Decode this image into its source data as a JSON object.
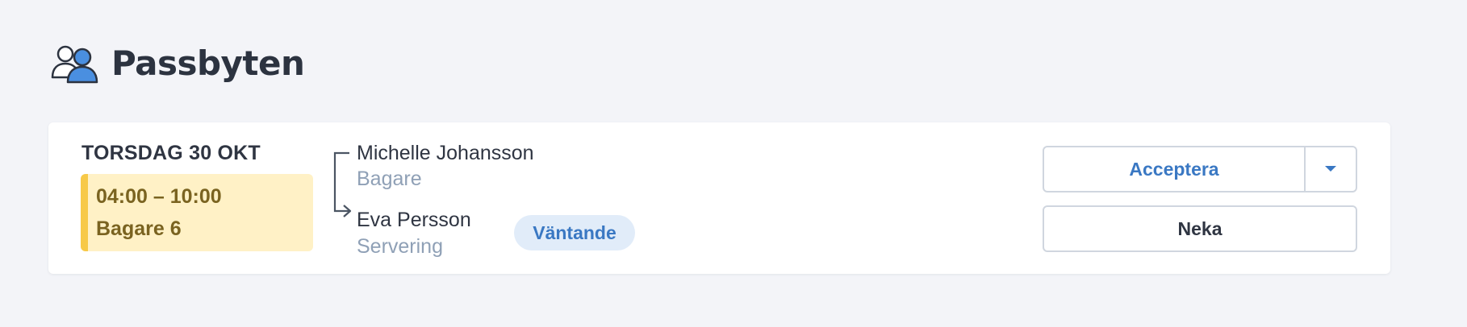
{
  "header": {
    "title": "Passbyten",
    "icon": "users-icon"
  },
  "request": {
    "date": "TORSDAG 30 OKT",
    "shift": {
      "time": "04:00 – 10:00",
      "role": "Bagare 6"
    },
    "from": {
      "name": "Michelle Johansson",
      "role": "Bagare"
    },
    "to": {
      "name": "Eva Persson",
      "role": "Servering"
    },
    "status": "Väntande"
  },
  "actions": {
    "accept_label": "Acceptera",
    "dropdown_icon": "caret-down-icon",
    "deny_label": "Neka"
  },
  "colors": {
    "background": "#f3f4f8",
    "accent": "#3a78c3",
    "shift_bg": "#fff1c6",
    "shift_bar": "#f7c948",
    "badge_bg": "#e1ecf9"
  }
}
